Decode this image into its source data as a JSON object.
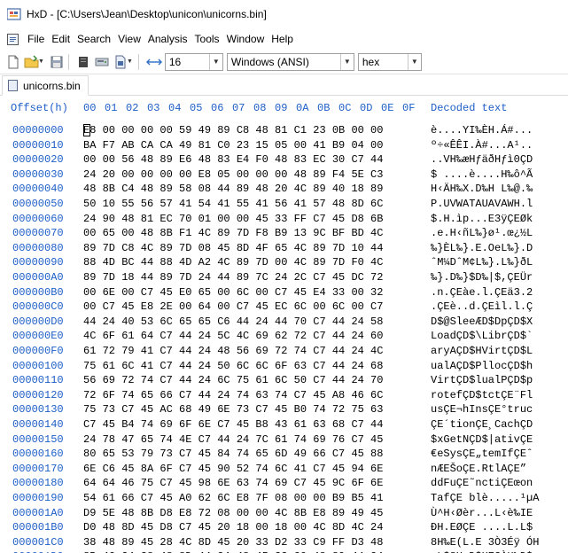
{
  "window": {
    "title": "HxD - [C:\\Users\\Jean\\Desktop\\unicon\\unicorns.bin]"
  },
  "menu": [
    "File",
    "Edit",
    "Search",
    "View",
    "Analysis",
    "Tools",
    "Window",
    "Help"
  ],
  "toolbar": {
    "bytes_per_row": "16",
    "charset": "Windows (ANSI)",
    "offset_base": "hex"
  },
  "tab": {
    "label": "unicorns.bin"
  },
  "hex_header": {
    "offset": "Offset(h)",
    "columns": [
      "00",
      "01",
      "02",
      "03",
      "04",
      "05",
      "06",
      "07",
      "08",
      "09",
      "0A",
      "0B",
      "0C",
      "0D",
      "0E",
      "0F"
    ],
    "decoded": "Decoded text"
  },
  "rows": [
    {
      "offset": "00000000",
      "bytes": "E8 00 00 00 00 59 49 89 C8 48 81 C1 23 0B 00 00",
      "text": "è....YI‰ÈH.Á#..."
    },
    {
      "offset": "00000010",
      "bytes": "BA F7 AB CA CA 49 81 C0 23 15 05 00 41 B9 04 00",
      "text": "º÷«ÊÊI.À#...A¹.."
    },
    {
      "offset": "00000020",
      "bytes": "00 00 56 48 89 E6 48 83 E4 F0 48 83 EC 30 C7 44",
      "text": "..VH‰æHƒäðHƒì0ÇD"
    },
    {
      "offset": "00000030",
      "bytes": "24 20 00 00 00 00 E8 05 00 00 00 48 89 F4 5E C3",
      "text": "$ ....è....H‰ô^Ã"
    },
    {
      "offset": "00000040",
      "bytes": "48 8B C4 48 89 58 08 44 89 48 20 4C 89 40 18 89",
      "text": "H‹ÄH‰X.D‰H L‰@.‰"
    },
    {
      "offset": "00000050",
      "bytes": "50 10 55 56 57 41 54 41 55 41 56 41 57 48 8D 6C",
      "text": "P.UVWATAUAVAWH.l"
    },
    {
      "offset": "00000060",
      "bytes": "24 90 48 81 EC 70 01 00 00 45 33 FF C7 45 D8 6B",
      "text": "$.H.ìp...E3ÿÇEØk"
    },
    {
      "offset": "00000070",
      "bytes": "00 65 00 48 8B F1 4C 89 7D F8 B9 13 9C BF BD 4C",
      "text": ".e.H‹ñL‰}ø¹.œ¿½L"
    },
    {
      "offset": "00000080",
      "bytes": "89 7D C8 4C 89 7D 08 45 8D 4F 65 4C 89 7D 10 44",
      "text": "‰}ÈL‰}.E.OeL‰}.D"
    },
    {
      "offset": "00000090",
      "bytes": "88 4D BC 44 88 4D A2 4C 89 7D 00 4C 89 7D F0 4C",
      "text": "ˆM¼DˆM¢L‰}.L‰}ðL"
    },
    {
      "offset": "000000A0",
      "bytes": "89 7D 18 44 89 7D 24 44 89 7C 24 2C C7 45 DC 72",
      "text": "‰}.D‰}$D‰|$,ÇEÜr"
    },
    {
      "offset": "000000B0",
      "bytes": "00 6E 00 C7 45 E0 65 00 6C 00 C7 45 E4 33 00 32",
      "text": ".n.ÇEàe.l.ÇEä3.2"
    },
    {
      "offset": "000000C0",
      "bytes": "00 C7 45 E8 2E 00 64 00 C7 45 EC 6C 00 6C 00 C7",
      "text": ".ÇEè..d.ÇEìl.l.Ç"
    },
    {
      "offset": "000000D0",
      "bytes": "44 24 40 53 6C 65 65 C6 44 24 44 70 C7 44 24 58",
      "text": "D$@SleeÆD$DpÇD$X"
    },
    {
      "offset": "000000E0",
      "bytes": "4C 6F 61 64 C7 44 24 5C 4C 69 62 72 C7 44 24 60",
      "text": "LoadÇD$\\LibrÇD$`"
    },
    {
      "offset": "000000F0",
      "bytes": "61 72 79 41 C7 44 24 48 56 69 72 74 C7 44 24 4C",
      "text": "aryAÇD$HVirtÇD$L"
    },
    {
      "offset": "00000100",
      "bytes": "75 61 6C 41 C7 44 24 50 6C 6C 6F 63 C7 44 24 68",
      "text": "ualAÇD$PllocÇD$h"
    },
    {
      "offset": "00000110",
      "bytes": "56 69 72 74 C7 44 24 6C 75 61 6C 50 C7 44 24 70",
      "text": "VirtÇD$lualPÇD$p"
    },
    {
      "offset": "00000120",
      "bytes": "72 6F 74 65 66 C7 44 24 74 63 74 C7 45 A8 46 6C",
      "text": "rotefÇD$tctÇE¨Fl"
    },
    {
      "offset": "00000130",
      "bytes": "75 73 C7 45 AC 68 49 6E 73 C7 45 B0 74 72 75 63",
      "text": "usÇE¬hInsÇE°truc"
    },
    {
      "offset": "00000140",
      "bytes": "C7 45 B4 74 69 6F 6E C7 45 B8 43 61 63 68 C7 44",
      "text": "ÇE´tionÇE¸CachÇD"
    },
    {
      "offset": "00000150",
      "bytes": "24 78 47 65 74 4E C7 44 24 7C 61 74 69 76 C7 45",
      "text": "$xGetNÇD$|ativÇE"
    },
    {
      "offset": "00000160",
      "bytes": "80 65 53 79 73 C7 45 84 74 65 6D 49 66 C7 45 88",
      "text": "€eSysÇE„temIfÇEˆ"
    },
    {
      "offset": "00000170",
      "bytes": "6E C6 45 8A 6F C7 45 90 52 74 6C 41 C7 45 94 6E",
      "text": "nÆEŠoÇE.RtlAÇE”"
    },
    {
      "offset": "00000180",
      "bytes": "64 64 46 75 C7 45 98 6E 63 74 69 C7 45 9C 6F 6E",
      "text": "ddFuÇE˜nctiÇEœon"
    },
    {
      "offset": "00000190",
      "bytes": "54 61 66 C7 45 A0 62 6C E8 7F 08 00 00 B9 B5 41",
      "text": "TafÇE blè.....¹µA"
    },
    {
      "offset": "000001A0",
      "bytes": "D9 5E 48 8B D8 E8 72 08 00 00 4C 8B E8 89 49 45",
      "text": "Ù^H‹Øèr...L‹è‰IE"
    },
    {
      "offset": "000001B0",
      "bytes": "D0 48 8D 45 D8 C7 45 20 18 00 18 00 4C 8D 4C 24",
      "text": "ÐH.EØÇE ....L.L$"
    },
    {
      "offset": "000001C0",
      "bytes": "38 48 89 45 28 4C 8D 45 20 33 D2 33 C9 FF D3 48",
      "text": "8H‰E(L.E 3Ò3Éÿ ÓH"
    },
    {
      "offset": "000001D0",
      "bytes": "8B 4C 24 38 48 8D 44 24 48 45 33 C0 48 89 44 24",
      "text": "‹L$8H.D$HE3ÀH‰D$"
    }
  ]
}
